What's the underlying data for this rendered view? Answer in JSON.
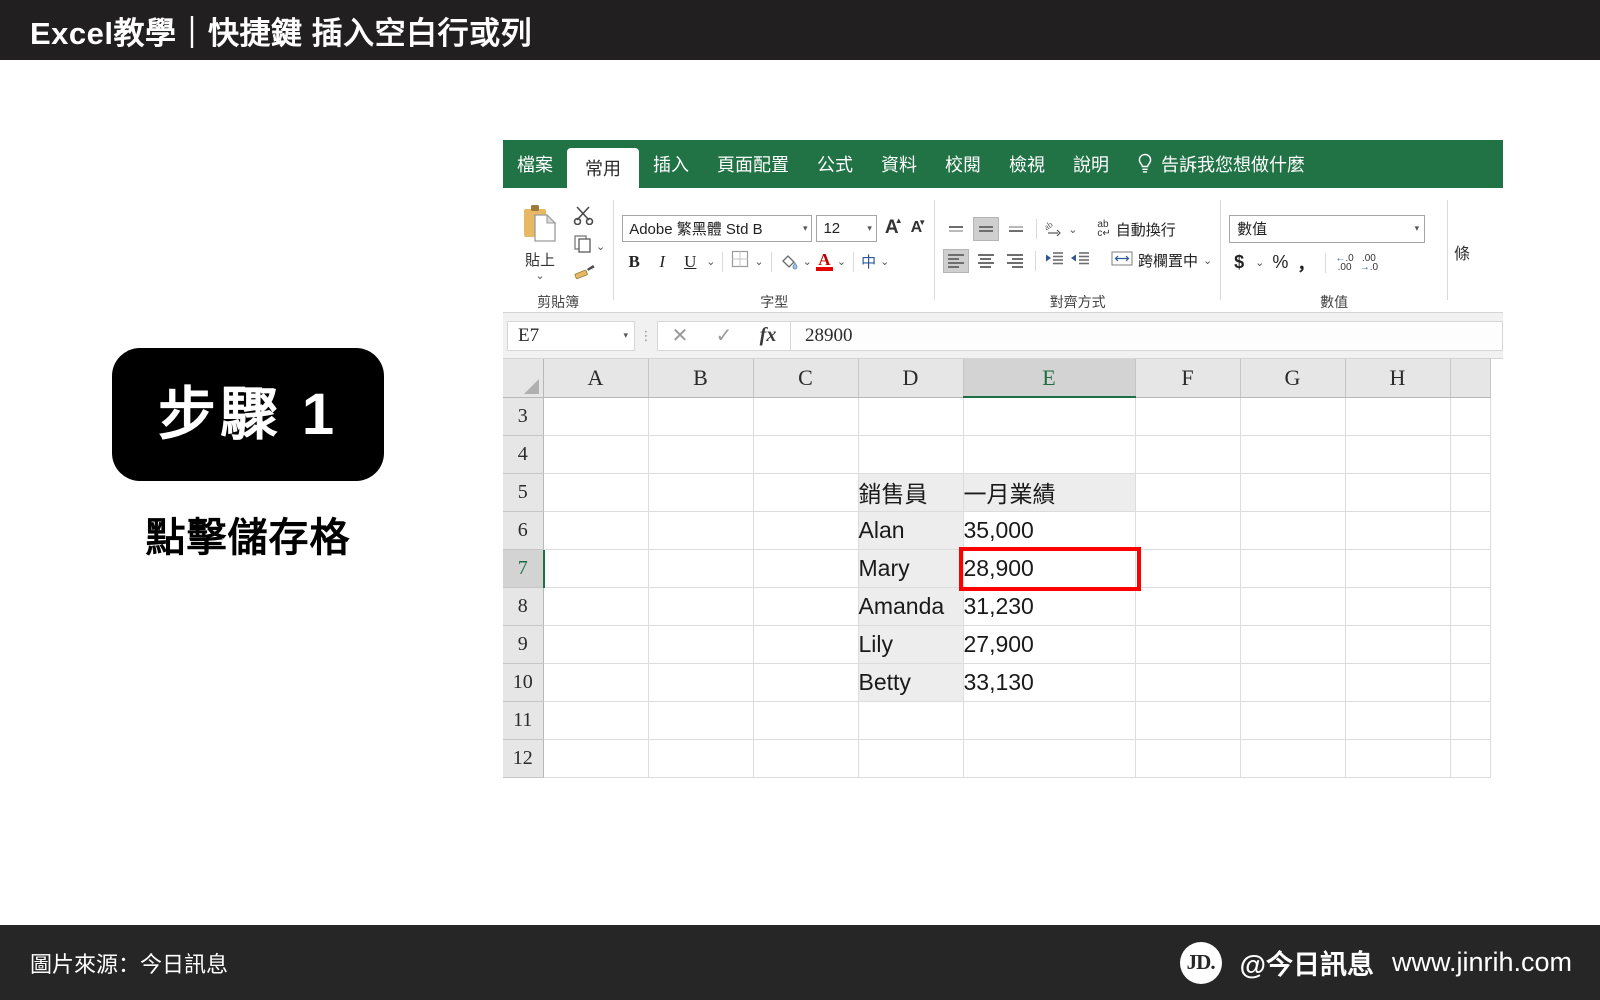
{
  "banner": {
    "title": "Excel教學｜快捷鍵 插入空白行或列"
  },
  "step": {
    "badge_label": "步驟 1",
    "caption": "點擊儲存格"
  },
  "excel": {
    "ribbon_tabs": [
      {
        "label": "檔案",
        "active": false
      },
      {
        "label": "常用",
        "active": true
      },
      {
        "label": "插入",
        "active": false
      },
      {
        "label": "頁面配置",
        "active": false
      },
      {
        "label": "公式",
        "active": false
      },
      {
        "label": "資料",
        "active": false
      },
      {
        "label": "校閱",
        "active": false
      },
      {
        "label": "檢視",
        "active": false
      },
      {
        "label": "說明",
        "active": false
      }
    ],
    "tell_me": {
      "icon": "lightbulb-icon",
      "label": "告訴我您想做什麼"
    },
    "groups": {
      "clipboard": {
        "label": "剪貼簿",
        "paste_label": "貼上",
        "icons": [
          "clipboard-icon",
          "scissors-icon",
          "copy-icon",
          "format-painter-icon"
        ]
      },
      "font": {
        "label": "字型",
        "font_name": "Adobe 繁黑體 Std B",
        "font_size": "12",
        "grow_font": "A",
        "shrink_font": "A",
        "bold": "B",
        "italic": "I",
        "underline": "U",
        "font_color_letter": "A",
        "font_color_hex": "#e60000",
        "phonetic": "中"
      },
      "alignment": {
        "label": "對齊方式",
        "wrap_text": "自動換行",
        "merge_center": "跨欄置中",
        "abc_icon": "abc-wrap-icon"
      },
      "number": {
        "label": "數值",
        "format": "數值",
        "currency": "$",
        "percent": "%",
        "comma": "，",
        "inc_decimal": ".00",
        "dec_decimal": ".00"
      },
      "tail": {
        "label": "條"
      }
    },
    "formula_bar": {
      "name_box": "E7",
      "cancel_icon": "cancel-icon",
      "confirm_icon": "confirm-icon",
      "function_icon": "fx-icon",
      "value": "28900"
    },
    "sheet": {
      "columns": [
        "A",
        "B",
        "C",
        "D",
        "E",
        "F",
        "G",
        "H"
      ],
      "selected_column": "E",
      "rows": [
        "3",
        "4",
        "5",
        "6",
        "7",
        "8",
        "9",
        "10",
        "11",
        "12"
      ],
      "selected_row": "7",
      "selected_cell": "E7",
      "cells": [
        {
          "row": "3",
          "D": "",
          "E": "",
          "shadeD": false,
          "shadeE": false
        },
        {
          "row": "4",
          "D": "",
          "E": "",
          "shadeD": false,
          "shadeE": false
        },
        {
          "row": "5",
          "D": "銷售員",
          "E": "一月業績",
          "shadeD": true,
          "shadeE": true
        },
        {
          "row": "6",
          "D": "Alan",
          "E": "35,000",
          "shadeD": true,
          "shadeE": false
        },
        {
          "row": "7",
          "D": "Mary",
          "E": "28,900",
          "shadeD": true,
          "shadeE": false
        },
        {
          "row": "8",
          "D": "Amanda",
          "E": "31,230",
          "shadeD": true,
          "shadeE": false
        },
        {
          "row": "9",
          "D": "Lily",
          "E": "27,900",
          "shadeD": true,
          "shadeE": false
        },
        {
          "row": "10",
          "D": "Betty",
          "E": "33,130",
          "shadeD": true,
          "shadeE": false
        },
        {
          "row": "11",
          "D": "",
          "E": "",
          "shadeD": false,
          "shadeE": false
        },
        {
          "row": "12",
          "D": "",
          "E": "",
          "shadeD": false,
          "shadeE": false
        }
      ],
      "highlight": {
        "target_cell": "E7",
        "color": "#ff0000"
      }
    }
  },
  "footer": {
    "source_text": "圖片來源：今日訊息",
    "logo_text": "JD.",
    "handle": "@今日訊息",
    "url": "www.jinrih.com"
  }
}
